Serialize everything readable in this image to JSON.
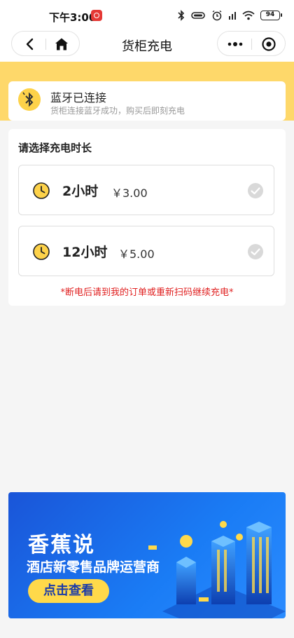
{
  "status_bar": {
    "time": "下午3:00",
    "battery": "94"
  },
  "nav": {
    "title": "货柜充电"
  },
  "bluetooth": {
    "title": "蓝牙已连接",
    "subtitle": "货柜连接蓝牙成功，购买后即刻充电"
  },
  "duration": {
    "heading": "请选择充电时长",
    "options": [
      {
        "hours": "2小时",
        "price": "￥3.00"
      },
      {
        "hours": "12小时",
        "price": "￥5.00"
      }
    ],
    "notice": "*断电后请到我的订单或重新扫码继续充电*"
  },
  "banner": {
    "title": "香蕉说",
    "subtitle": "酒店新零售品牌运营商",
    "cta": "点击查看"
  },
  "colors": {
    "accent_yellow": "#fed86a",
    "notice_red": "#e02020",
    "banner_blue": "#1a7cf5"
  }
}
